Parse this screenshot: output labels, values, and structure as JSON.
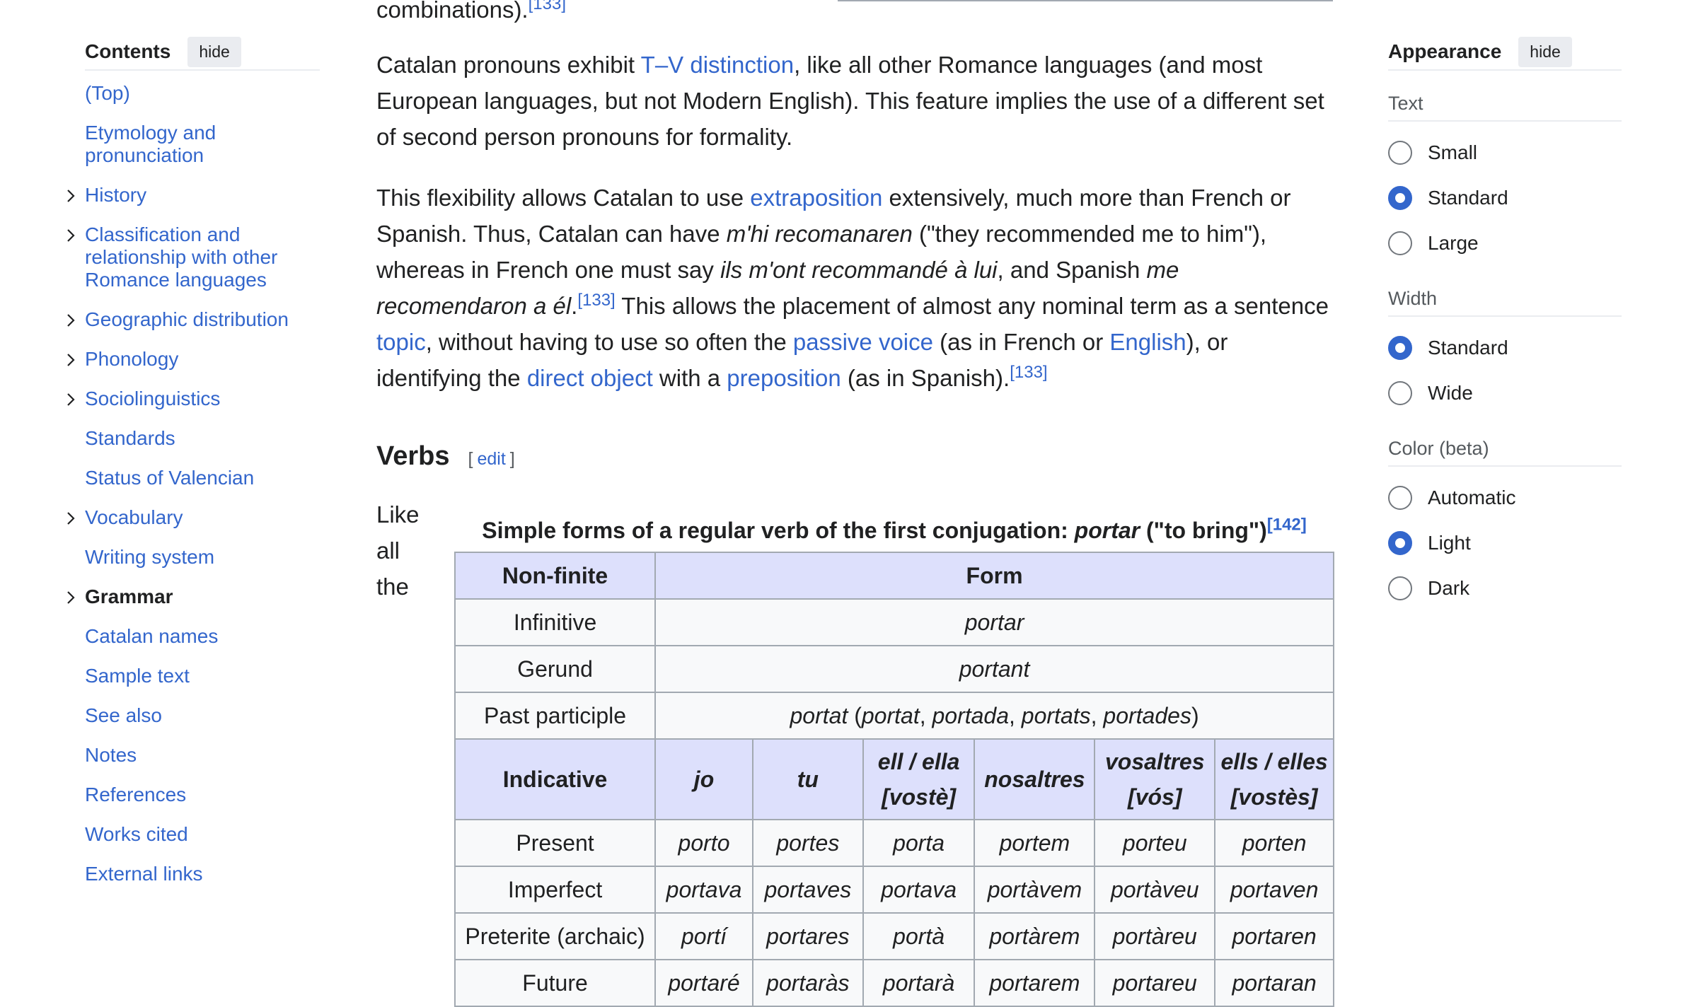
{
  "toc": {
    "title": "Contents",
    "hide_label": "hide",
    "items": [
      {
        "label": "(Top)",
        "expandable": false
      },
      {
        "label": "Etymology and pronunciation",
        "expandable": false
      },
      {
        "label": "History",
        "expandable": true
      },
      {
        "label": "Classification and relationship with other Romance languages",
        "expandable": true
      },
      {
        "label": "Geographic distribution",
        "expandable": true
      },
      {
        "label": "Phonology",
        "expandable": true
      },
      {
        "label": "Sociolinguistics",
        "expandable": true
      },
      {
        "label": "Standards",
        "expandable": false
      },
      {
        "label": "Status of Valencian",
        "expandable": false
      },
      {
        "label": "Vocabulary",
        "expandable": true
      },
      {
        "label": "Writing system",
        "expandable": false
      },
      {
        "label": "Grammar",
        "expandable": true,
        "active": true
      },
      {
        "label": "Catalan names",
        "expandable": false
      },
      {
        "label": "Sample text",
        "expandable": false
      },
      {
        "label": "See also",
        "expandable": false
      },
      {
        "label": "Notes",
        "expandable": false
      },
      {
        "label": "References",
        "expandable": false
      },
      {
        "label": "Works cited",
        "expandable": false
      },
      {
        "label": "External links",
        "expandable": false
      }
    ]
  },
  "content": {
    "top_fragment": "combinations).",
    "top_ref": "[133]",
    "p1": {
      "t1": "Catalan pronouns exhibit ",
      "link1": "T–V distinction",
      "t2": ", like all other Romance languages (and most European languages, but not Modern English). This feature implies the use of a different set of second person pronouns for formality."
    },
    "p2": {
      "t1": "This flexibility allows Catalan to use ",
      "link1": "extraposition",
      "t2": " extensively, much more than French or Spanish. Thus, Catalan can have ",
      "ex1": "m'hi recomanaren",
      "t3": " (\"they recommended me to him\"), whereas in French one must say ",
      "ex2": "ils m'ont recommandé à lui",
      "t4": ", and Spanish ",
      "ex3": "me recomendaron a él",
      "t5": ".",
      "ref1": "[133]",
      "t6": " This allows the placement of almost any nominal term as a sentence ",
      "link2": "topic",
      "t7": ", without having to use so often the ",
      "link3": "passive voice",
      "t8": " (as in French or ",
      "link4": "English",
      "t9": "), or identifying the ",
      "link5": "direct object",
      "t10": " with a ",
      "link6": "preposition",
      "t11": " (as in Spanish).",
      "ref2": "[133]"
    },
    "verbs_heading": "Verbs",
    "edit_label": "edit",
    "like_text": [
      "Like",
      "all",
      "the"
    ]
  },
  "verb_table": {
    "caption_a": "Simple forms of a regular verb of the first conjugation: ",
    "caption_verb": "portar",
    "caption_b": " (\"to bring\")",
    "caption_ref": "[142]",
    "nonfinite_header": "Non-finite",
    "form_header": "Form",
    "nonfinite_rows": [
      {
        "label": "Infinitive",
        "form": "portar"
      },
      {
        "label": "Gerund",
        "form": "portant"
      }
    ],
    "past_participle": {
      "label": "Past participle",
      "main": "portat",
      "open": " (",
      "f1": "portat",
      "c1": ", ",
      "f2": "portada",
      "c2": ", ",
      "f3": "portats",
      "c3": ", ",
      "f4": "portades",
      "close": ")"
    },
    "indicative_header": "Indicative",
    "pronouns": [
      {
        "main": "jo",
        "sub": ""
      },
      {
        "main": "tu",
        "sub": ""
      },
      {
        "main": "ell / ella",
        "sub": "vostè"
      },
      {
        "main": "nosaltres",
        "sub": ""
      },
      {
        "main": "vosaltres",
        "sub": "vós"
      },
      {
        "main": "ells / elles",
        "sub": "vostès"
      }
    ],
    "indicative_rows": [
      {
        "label": "Present",
        "forms": [
          "porto",
          "portes",
          "porta",
          "portem",
          "porteu",
          "porten"
        ]
      },
      {
        "label": "Imperfect",
        "forms": [
          "portava",
          "portaves",
          "portava",
          "portàvem",
          "portàveu",
          "portaven"
        ]
      },
      {
        "label": "Preterite (archaic)",
        "forms": [
          "portí",
          "portares",
          "portà",
          "portàrem",
          "portàreu",
          "portaren"
        ]
      },
      {
        "label": "Future",
        "forms": [
          "portaré",
          "portaràs",
          "portarà",
          "portarem",
          "portareu",
          "portaran"
        ]
      }
    ]
  },
  "appearance": {
    "title": "Appearance",
    "hide_label": "hide",
    "groups": [
      {
        "label": "Text",
        "options": [
          {
            "label": "Small",
            "selected": false
          },
          {
            "label": "Standard",
            "selected": true
          },
          {
            "label": "Large",
            "selected": false
          }
        ]
      },
      {
        "label": "Width",
        "options": [
          {
            "label": "Standard",
            "selected": true
          },
          {
            "label": "Wide",
            "selected": false
          }
        ]
      },
      {
        "label": "Color (beta)",
        "options": [
          {
            "label": "Automatic",
            "selected": false
          },
          {
            "label": "Light",
            "selected": true
          },
          {
            "label": "Dark",
            "selected": false
          }
        ]
      }
    ]
  },
  "colors": {
    "link": "#3366cc",
    "table_header": "#dde0fc",
    "radio_selected": "#3366cc"
  }
}
